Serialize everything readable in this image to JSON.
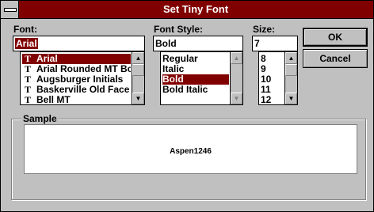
{
  "window": {
    "title": "Set Tiny Font"
  },
  "font": {
    "label": "Font:",
    "value": "Arial",
    "items": [
      {
        "icon": "truetype-icon",
        "glyph": "T",
        "label": "Arial",
        "selected": true
      },
      {
        "icon": "truetype-icon",
        "glyph": "T",
        "label": "Arial Rounded MT Bold",
        "selected": false
      },
      {
        "icon": "truetype-icon",
        "glyph": "T",
        "label": "Augsburger Initials",
        "selected": false
      },
      {
        "icon": "truetype-icon",
        "glyph": "T",
        "label": "Baskerville Old Face",
        "selected": false
      },
      {
        "icon": "truetype-icon",
        "glyph": "T",
        "label": "Bell MT",
        "selected": false
      }
    ]
  },
  "style": {
    "label": "Font Style:",
    "value": "Bold",
    "items": [
      {
        "label": "Regular",
        "selected": false
      },
      {
        "label": "Italic",
        "selected": false
      },
      {
        "label": "Bold",
        "selected": true
      },
      {
        "label": "Bold Italic",
        "selected": false
      }
    ]
  },
  "size": {
    "label": "Size:",
    "value": "7",
    "items": [
      {
        "label": "8",
        "selected": false
      },
      {
        "label": "9",
        "selected": false
      },
      {
        "label": "10",
        "selected": false
      },
      {
        "label": "11",
        "selected": false
      },
      {
        "label": "12",
        "selected": false
      }
    ]
  },
  "buttons": {
    "ok": "OK",
    "cancel": "Cancel"
  },
  "sample": {
    "label": "Sample",
    "text": "Aspen1246"
  },
  "colors": {
    "selection": "#800000",
    "titlebar": "#800000",
    "face": "#c0c0c0"
  },
  "icons": {
    "scroll_up": "scroll-up-arrow-icon",
    "scroll_down": "scroll-down-arrow-icon"
  }
}
